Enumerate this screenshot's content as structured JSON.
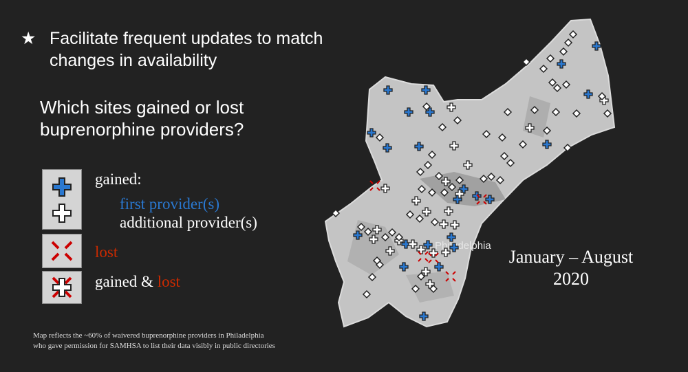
{
  "bullet": {
    "icon": "star-icon",
    "symbol": "★",
    "text_line1": "Facilitate frequent updates to match",
    "text_line2": "changes in availability"
  },
  "question": {
    "line1": "Which sites gained or lost",
    "line2": "buprenorphine providers?"
  },
  "legend": {
    "gained": "gained:",
    "first": "first provider(s)",
    "additional": "additional provider(s)",
    "lost": "lost",
    "gained_and": "gained & ",
    "gained_lost_lost": "lost"
  },
  "map": {
    "city_label": "Philadelphia",
    "markers": [
      "first-provider",
      "additional-provider",
      "lost",
      "gained-and-lost",
      "unchanged-site"
    ]
  },
  "dates": {
    "line1": "January – August",
    "line2": "2020"
  },
  "footnote": {
    "line1": "Map reflects the ~60% of waivered buprenorphine providers in Philadelphia",
    "line2": "who gave permission for SAMHSA to list their data visibly in public directories"
  },
  "colors": {
    "background": "#222222",
    "blue": "#2a78d0",
    "red": "#cc2200",
    "map_land": "#c4c4c4"
  }
}
